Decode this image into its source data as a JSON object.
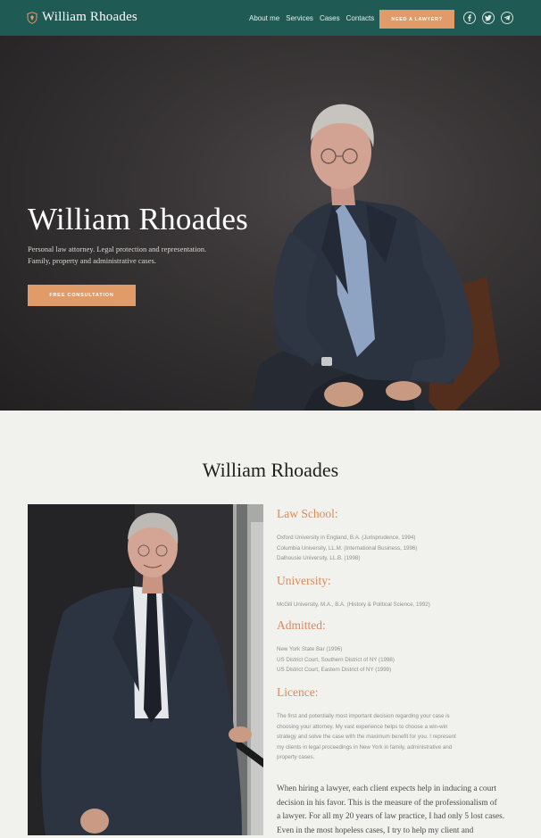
{
  "nav": {
    "brand": "William Rhoades",
    "links": [
      "About me",
      "Services",
      "Cases",
      "Contacts"
    ],
    "cta": "NEED A LAWYER?",
    "social": [
      "facebook-icon",
      "twitter-icon",
      "telegram-icon"
    ],
    "bg_color": "#1f5a55",
    "accent_color": "#e19b68"
  },
  "hero": {
    "title": "William Rhoades",
    "subtitle_line1": "Personal law attorney. Legal protection and representation.",
    "subtitle_line2": "Family, property and administrative cases.",
    "button": "FREE CONSULTATION"
  },
  "about": {
    "title": "William Rhoades",
    "law_school": {
      "heading": "Law School:",
      "items": [
        "Oxford University in England, B.A. (Jurisprudence, 1994)",
        "Columbia University, LL.M. (International Business, 1996)",
        "Dalhousie University, LL.B. (1998)"
      ]
    },
    "university": {
      "heading": "University:",
      "items": [
        "McGill University, M.A., B.A. (History & Political Science, 1992)"
      ]
    },
    "admitted": {
      "heading": "Admitted:",
      "items": [
        "New York State Bar (1996)",
        "US District Court, Southern District of NY (1998)",
        "US District Court, Eastern District of NY (1999)"
      ]
    },
    "licence": {
      "heading": "Licence:",
      "lines": [
        "The first and potentially most important decision regarding your case is",
        "choosing your attorney. My vast experience helps to choose a win-win",
        "strategy and solve the case with the maximum benefit for you. I represent",
        "my clients in legal proceedings in New York in family, administrative and",
        "property cases."
      ]
    },
    "paragraph_lines": [
      "When hiring a lawyer, each client expects help in inducing a court",
      "decision in his favor. This is the measure of the professionalism of",
      "a lawyer. For all my 20 years of law practice, I had only 5 lost cases.",
      "Even in the most hopeless cases, I try to help my client and"
    ]
  }
}
